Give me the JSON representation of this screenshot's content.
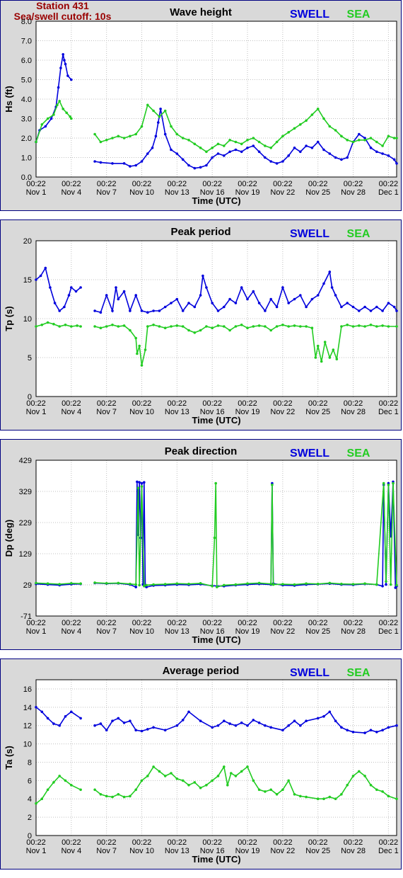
{
  "station": {
    "name": "Station 431",
    "cutoff": "Sea/swell cutoff: 10s"
  },
  "legend": {
    "swell": "SWELL",
    "sea": "SEA"
  },
  "colors": {
    "swell": "#0000dd",
    "sea": "#22cc22",
    "station_text": "#990000",
    "border": "#000080"
  },
  "x_axis": {
    "label": "Time (UTC)",
    "ticks": [
      {
        "day": 0,
        "time": "00:22",
        "date": "Nov 1"
      },
      {
        "day": 3,
        "time": "00:22",
        "date": "Nov 4"
      },
      {
        "day": 6,
        "time": "00:22",
        "date": "Nov 7"
      },
      {
        "day": 9,
        "time": "00:22",
        "date": "Nov 10"
      },
      {
        "day": 12,
        "time": "00:22",
        "date": "Nov 13"
      },
      {
        "day": 15,
        "time": "00:22",
        "date": "Nov 16"
      },
      {
        "day": 18,
        "time": "00:22",
        "date": "Nov 19"
      },
      {
        "day": 21,
        "time": "00:22",
        "date": "Nov 22"
      },
      {
        "day": 24,
        "time": "00:22",
        "date": "Nov 25"
      },
      {
        "day": 27,
        "time": "00:22",
        "date": "Nov 28"
      },
      {
        "day": 30,
        "time": "00:22",
        "date": "Dec 1"
      }
    ],
    "range": [
      0,
      30.7
    ]
  },
  "chart_data": [
    {
      "type": "line",
      "title": "Wave height",
      "ylabel": "Hs (ft)",
      "ylim": [
        0,
        8
      ],
      "yticks": [
        "0.0",
        "1.0",
        "2.0",
        "3.0",
        "4.0",
        "5.0",
        "6.0",
        "7.0",
        "8.0"
      ],
      "grid": true,
      "legend": "top-right",
      "series": [
        {
          "name": "SWELL",
          "x": [
            0,
            0.3,
            0.8,
            1.3,
            1.7,
            1.9,
            2.1,
            2.3,
            2.4,
            2.5,
            2.7,
            3.0,
            5.0,
            5.5,
            6.5,
            7.5,
            8.0,
            8.5,
            9.0,
            9.5,
            9.9,
            10.2,
            10.4,
            10.6,
            11.0,
            11.5,
            12.0,
            12.5,
            13.0,
            13.5,
            14.0,
            14.5,
            15.0,
            15.5,
            16.0,
            16.5,
            17.0,
            17.5,
            18.0,
            18.5,
            19.0,
            19.5,
            20.0,
            20.5,
            21.0,
            21.5,
            22.0,
            22.5,
            23.0,
            23.5,
            24.0,
            24.5,
            25.0,
            25.5,
            26.0,
            26.5,
            27.0,
            27.5,
            28.0,
            28.5,
            29.0,
            29.5,
            30.0,
            30.5,
            30.7
          ],
          "y": [
            1.8,
            2.4,
            2.6,
            3.0,
            3.6,
            4.6,
            5.6,
            6.3,
            6.0,
            5.8,
            5.2,
            5.0,
            0.8,
            0.75,
            0.7,
            0.7,
            0.55,
            0.6,
            0.8,
            1.2,
            1.5,
            2.1,
            2.8,
            3.5,
            2.2,
            1.4,
            1.2,
            0.9,
            0.6,
            0.45,
            0.5,
            0.6,
            1.0,
            1.2,
            1.1,
            1.3,
            1.4,
            1.3,
            1.5,
            1.6,
            1.3,
            1.0,
            0.8,
            0.7,
            0.8,
            1.1,
            1.5,
            1.3,
            1.6,
            1.5,
            1.8,
            1.4,
            1.2,
            1.0,
            0.9,
            1.0,
            1.8,
            2.2,
            2.0,
            1.5,
            1.3,
            1.2,
            1.1,
            0.9,
            0.7
          ]
        },
        {
          "name": "SEA",
          "x": [
            0,
            0.5,
            1.0,
            1.5,
            1.8,
            2.0,
            2.3,
            2.6,
            2.9,
            3.0,
            5.0,
            5.5,
            6.0,
            6.5,
            7.0,
            7.5,
            8.0,
            8.5,
            9.0,
            9.5,
            10.0,
            10.5,
            11.0,
            11.5,
            12.0,
            12.5,
            13.0,
            13.5,
            14.0,
            14.5,
            15.0,
            15.5,
            16.0,
            16.5,
            17.0,
            17.5,
            18.0,
            18.5,
            19.0,
            19.5,
            20.0,
            20.5,
            21.0,
            21.5,
            22.0,
            22.5,
            23.0,
            23.5,
            24.0,
            24.5,
            25.0,
            25.5,
            26.0,
            26.5,
            27.0,
            27.5,
            28.0,
            28.5,
            29.0,
            29.5,
            30.0,
            30.5,
            30.7
          ],
          "y": [
            1.8,
            2.7,
            3.0,
            3.2,
            3.7,
            3.9,
            3.5,
            3.3,
            3.1,
            3.0,
            2.2,
            1.8,
            1.9,
            2.0,
            2.1,
            2.0,
            2.1,
            2.2,
            2.6,
            3.7,
            3.4,
            3.1,
            3.4,
            2.6,
            2.2,
            2.0,
            1.9,
            1.7,
            1.5,
            1.3,
            1.5,
            1.7,
            1.6,
            1.9,
            1.8,
            1.7,
            1.9,
            2.0,
            1.8,
            1.6,
            1.5,
            1.8,
            2.1,
            2.3,
            2.5,
            2.7,
            2.9,
            3.2,
            3.5,
            3.0,
            2.6,
            2.4,
            2.1,
            1.9,
            1.8,
            1.9,
            1.9,
            2.0,
            1.8,
            1.6,
            2.1,
            2.0,
            2.0
          ]
        }
      ]
    },
    {
      "type": "line",
      "title": "Peak period",
      "ylabel": "Tp (s)",
      "ylim": [
        0,
        20
      ],
      "yticks": [
        "0",
        "5",
        "10",
        "15",
        "20"
      ],
      "grid": true,
      "legend": "top-right",
      "series": [
        {
          "name": "SWELL",
          "x": [
            0,
            0.4,
            0.8,
            1.2,
            1.6,
            2.0,
            2.4,
            2.8,
            3.0,
            3.4,
            3.8,
            5.0,
            5.5,
            6.0,
            6.5,
            6.8,
            7.0,
            7.5,
            8.0,
            8.5,
            9.0,
            9.5,
            10.0,
            10.5,
            11.0,
            11.5,
            12.0,
            12.5,
            13.0,
            13.5,
            14.0,
            14.2,
            14.5,
            15.0,
            15.5,
            16.0,
            16.5,
            17.0,
            17.5,
            18.0,
            18.5,
            19.0,
            19.5,
            20.0,
            20.5,
            21.0,
            21.5,
            22.0,
            22.5,
            23.0,
            23.5,
            24.0,
            24.5,
            25.0,
            25.2,
            25.5,
            26.0,
            26.5,
            27.0,
            27.5,
            28.0,
            28.5,
            29.0,
            29.5,
            30.0,
            30.5,
            30.7
          ],
          "y": [
            15.0,
            15.5,
            16.5,
            14.0,
            12.0,
            11.0,
            11.5,
            13.0,
            14.0,
            13.5,
            14.0,
            11.0,
            10.8,
            13.0,
            11.0,
            14.0,
            12.5,
            13.5,
            11.0,
            13.0,
            11.0,
            10.8,
            11.0,
            11.0,
            11.5,
            12.0,
            12.5,
            11.0,
            12.0,
            11.5,
            13.0,
            15.5,
            14.0,
            12.0,
            11.0,
            11.5,
            12.5,
            12.0,
            14.0,
            12.5,
            13.5,
            12.0,
            11.0,
            12.5,
            11.5,
            14.0,
            12.0,
            12.5,
            13.0,
            11.5,
            12.5,
            13.0,
            14.5,
            16.0,
            14.0,
            13.0,
            11.5,
            12.0,
            11.5,
            11.0,
            11.5,
            11.0,
            11.5,
            11.0,
            12.0,
            11.5,
            11.0
          ]
        },
        {
          "name": "SEA",
          "x": [
            0,
            0.5,
            1.0,
            1.5,
            2.0,
            2.5,
            3.0,
            3.5,
            3.8,
            5.0,
            5.5,
            6.0,
            6.5,
            7.0,
            7.5,
            8.0,
            8.5,
            8.6,
            8.8,
            9.0,
            9.3,
            9.5,
            10.0,
            10.5,
            11.0,
            11.5,
            12.0,
            12.5,
            13.0,
            13.5,
            14.0,
            14.5,
            15.0,
            15.5,
            16.0,
            16.5,
            17.0,
            17.5,
            18.0,
            18.5,
            19.0,
            19.5,
            20.0,
            20.5,
            21.0,
            21.5,
            22.0,
            22.5,
            23.0,
            23.5,
            23.8,
            24.0,
            24.3,
            24.6,
            25.0,
            25.3,
            25.6,
            26.0,
            26.5,
            27.0,
            27.5,
            28.0,
            28.5,
            29.0,
            29.5,
            30.0,
            30.7
          ],
          "y": [
            9.0,
            9.2,
            9.5,
            9.3,
            9.0,
            9.2,
            9.0,
            9.1,
            9.0,
            9.0,
            8.8,
            9.0,
            9.2,
            9.0,
            9.1,
            8.5,
            7.5,
            5.5,
            6.5,
            4.0,
            6.0,
            9.0,
            9.2,
            9.0,
            8.8,
            9.0,
            9.1,
            9.0,
            8.5,
            8.2,
            8.5,
            9.0,
            8.8,
            9.1,
            9.0,
            8.5,
            9.0,
            9.2,
            8.8,
            9.0,
            9.1,
            9.0,
            8.5,
            9.0,
            9.2,
            9.0,
            9.1,
            9.0,
            9.0,
            8.8,
            5.0,
            6.5,
            4.5,
            7.0,
            5.0,
            6.0,
            4.8,
            9.0,
            9.2,
            9.0,
            9.1,
            9.0,
            9.2,
            9.0,
            9.1,
            9.0,
            9.0
          ]
        }
      ]
    },
    {
      "type": "line",
      "title": "Peak direction",
      "ylabel": "Dp (deg)",
      "ylim": [
        -71,
        429
      ],
      "yticks": [
        "-71",
        "29",
        "129",
        "229",
        "329",
        "429"
      ],
      "grid": true,
      "legend": "top-right",
      "series": [
        {
          "name": "SWELL",
          "x": [
            0,
            1.0,
            2.0,
            3.0,
            3.8,
            5.0,
            6.0,
            7.0,
            8.0,
            8.5,
            8.6,
            8.7,
            8.8,
            8.9,
            9.0,
            9.1,
            9.2,
            9.3,
            9.4,
            10.0,
            11.0,
            12.0,
            13.0,
            14.0,
            15.0,
            16.0,
            17.0,
            18.0,
            19.0,
            20.0,
            20.1,
            20.2,
            21.0,
            22.0,
            23.0,
            24.0,
            25.0,
            26.0,
            27.0,
            28.0,
            29.0,
            29.5,
            29.6,
            29.8,
            30.0,
            30.2,
            30.4,
            30.6,
            30.7
          ],
          "y": [
            32,
            30,
            28,
            31,
            32,
            35,
            33,
            34,
            30,
            22,
            360,
            190,
            358,
            180,
            355,
            30,
            358,
            25,
            22,
            27,
            28,
            30,
            29,
            31,
            26,
            25,
            28,
            30,
            32,
            30,
            355,
            33,
            28,
            27,
            30,
            31,
            33,
            30,
            29,
            32,
            30,
            25,
            350,
            30,
            355,
            185,
            360,
            20,
            25
          ]
        },
        {
          "name": "SEA",
          "x": [
            0,
            1.0,
            2.0,
            3.0,
            3.8,
            5.0,
            6.0,
            7.0,
            8.0,
            8.5,
            8.7,
            8.8,
            9.0,
            9.2,
            9.4,
            10.0,
            11.0,
            12.0,
            13.0,
            14.0,
            15.0,
            15.2,
            15.3,
            15.4,
            16.0,
            17.0,
            18.0,
            19.0,
            20.0,
            20.1,
            20.2,
            21.0,
            22.0,
            23.0,
            24.0,
            25.0,
            26.0,
            27.0,
            28.0,
            29.0,
            29.6,
            29.8,
            30.0,
            30.2,
            30.4,
            30.7
          ],
          "y": [
            35,
            33,
            31,
            34,
            33,
            36,
            34,
            35,
            32,
            30,
            340,
            28,
            345,
            25,
            28,
            30,
            31,
            33,
            32,
            34,
            25,
            180,
            355,
            22,
            28,
            30,
            33,
            35,
            32,
            350,
            30,
            31,
            30,
            33,
            32,
            35,
            32,
            31,
            33,
            30,
            355,
            40,
            350,
            30,
            355,
            28
          ]
        }
      ]
    },
    {
      "type": "line",
      "title": "Average period",
      "ylabel": "Ta (s)",
      "ylim": [
        0,
        17
      ],
      "yticks": [
        "0",
        "2",
        "4",
        "6",
        "8",
        "10",
        "12",
        "14",
        "16"
      ],
      "grid": true,
      "legend": "top-right",
      "series": [
        {
          "name": "SWELL",
          "x": [
            0,
            0.5,
            1.0,
            1.5,
            2.0,
            2.5,
            3.0,
            3.8,
            5.0,
            5.5,
            6.0,
            6.5,
            7.0,
            7.5,
            8.0,
            8.5,
            9.0,
            9.5,
            10.0,
            11.0,
            12.0,
            12.5,
            13.0,
            14.0,
            15.0,
            15.5,
            16.0,
            16.5,
            17.0,
            17.5,
            18.0,
            18.5,
            19.0,
            19.5,
            20.0,
            21.0,
            21.5,
            22.0,
            22.5,
            23.0,
            24.0,
            24.5,
            25.0,
            25.5,
            26.0,
            26.5,
            27.0,
            28.0,
            28.5,
            29.0,
            29.5,
            30.0,
            30.7
          ],
          "y": [
            14.0,
            13.5,
            12.8,
            12.2,
            12.0,
            13.0,
            13.5,
            12.8,
            12.0,
            12.2,
            11.5,
            12.5,
            12.8,
            12.3,
            12.5,
            11.5,
            11.4,
            11.6,
            11.8,
            11.5,
            12.0,
            12.6,
            13.5,
            12.5,
            11.8,
            12.0,
            12.5,
            12.2,
            12.0,
            12.3,
            12.0,
            12.6,
            12.3,
            12.0,
            11.8,
            11.5,
            12.0,
            12.5,
            12.0,
            12.5,
            12.8,
            13.0,
            13.5,
            12.5,
            11.8,
            11.5,
            11.3,
            11.2,
            11.5,
            11.3,
            11.5,
            11.8,
            12.0
          ]
        },
        {
          "name": "SEA",
          "x": [
            0,
            0.5,
            1.0,
            1.5,
            2.0,
            2.5,
            3.0,
            3.8,
            5.0,
            5.5,
            6.0,
            6.5,
            7.0,
            7.5,
            8.0,
            8.5,
            9.0,
            9.5,
            10.0,
            10.5,
            11.0,
            11.5,
            12.0,
            12.5,
            13.0,
            13.5,
            14.0,
            14.5,
            15.0,
            15.5,
            16.0,
            16.3,
            16.6,
            17.0,
            17.5,
            18.0,
            18.5,
            19.0,
            19.5,
            20.0,
            20.5,
            21.0,
            21.5,
            22.0,
            22.5,
            23.0,
            24.0,
            24.5,
            25.0,
            25.5,
            26.0,
            26.5,
            27.0,
            27.5,
            28.0,
            28.5,
            29.0,
            29.5,
            30.0,
            30.7
          ],
          "y": [
            3.5,
            4.0,
            5.0,
            5.8,
            6.5,
            6.0,
            5.5,
            5.0,
            5.0,
            4.5,
            4.3,
            4.2,
            4.5,
            4.2,
            4.3,
            5.0,
            6.0,
            6.5,
            7.5,
            7.0,
            6.5,
            6.8,
            6.2,
            6.0,
            5.5,
            5.8,
            5.2,
            5.5,
            6.0,
            6.5,
            7.5,
            5.5,
            6.8,
            6.5,
            7.0,
            7.5,
            6.0,
            5.0,
            4.8,
            5.0,
            4.5,
            5.0,
            6.0,
            4.5,
            4.3,
            4.2,
            4.0,
            4.0,
            4.2,
            4.0,
            4.5,
            5.5,
            6.5,
            7.0,
            6.5,
            5.5,
            5.0,
            4.8,
            4.3,
            4.0
          ]
        }
      ]
    }
  ]
}
